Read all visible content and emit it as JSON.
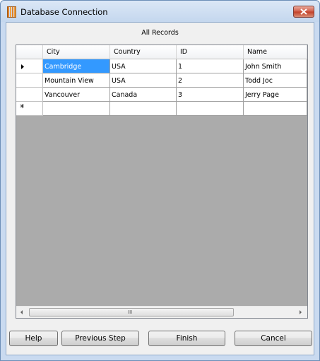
{
  "window": {
    "title": "Database Connection"
  },
  "grid": {
    "caption": "All Records",
    "columns": [
      "City",
      "Country",
      "ID",
      "Name"
    ],
    "rows": [
      [
        "Cambridge",
        "USA",
        "1",
        "John Smith"
      ],
      [
        "Mountain View",
        "USA",
        "2",
        "Todd Joc"
      ],
      [
        "Vancouver",
        "Canada",
        "3",
        "Jerry Page"
      ]
    ],
    "new_row_marker": "*",
    "current_row_marker": "arrow-right-icon",
    "selected_cell": "Cambridge",
    "scroll_grip": "III"
  },
  "buttons": {
    "help": "Help",
    "previous_step": "Previous Step",
    "finish": "Finish",
    "cancel": "Cancel"
  },
  "colors": {
    "selection": "#3399ff",
    "grid_background": "#ababab",
    "window_frame": "#c9daf0"
  }
}
